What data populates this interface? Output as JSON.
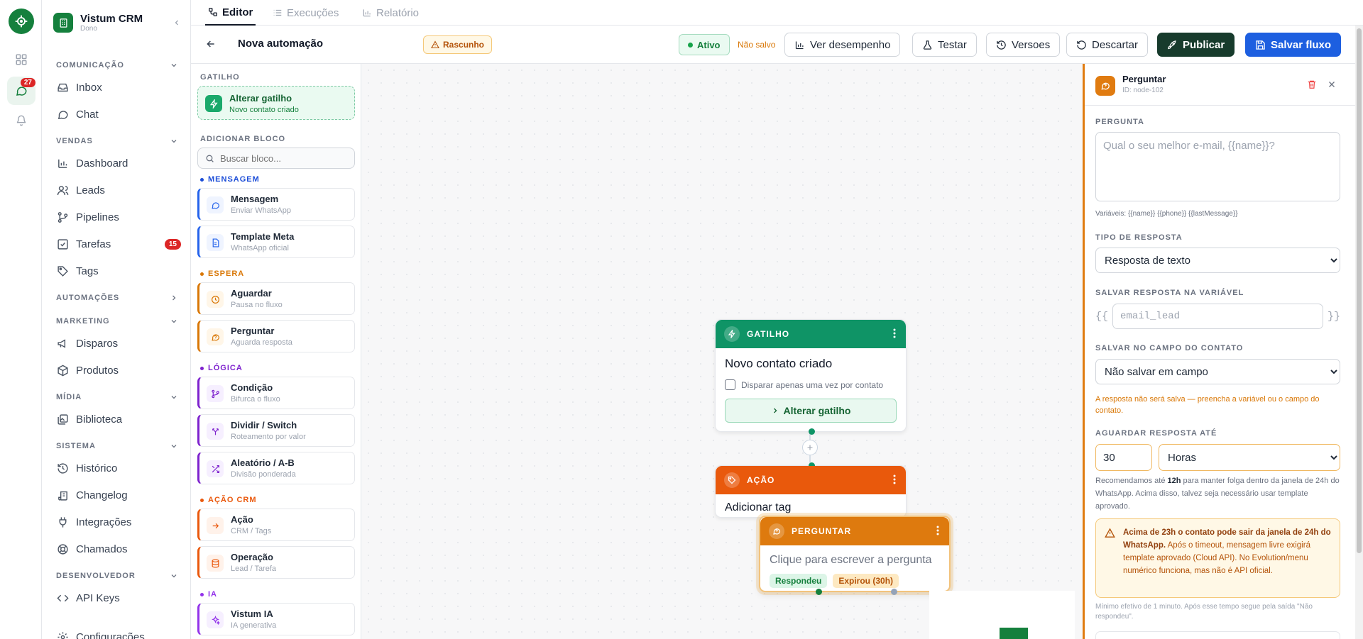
{
  "rail": {
    "badge": "27"
  },
  "workspace": {
    "name": "Vistum CRM",
    "role": "Dono"
  },
  "sidebar": {
    "comunicacao": "COMUNICAÇÃO",
    "inbox": "Inbox",
    "chat": "Chat",
    "vendas": "VENDAS",
    "dashboard": "Dashboard",
    "leads": "Leads",
    "pipelines": "Pipelines",
    "tarefas": "Tarefas",
    "tarefas_count": "15",
    "tags": "Tags",
    "automacoes": "AUTOMAÇÕES",
    "marketing": "MARKETING",
    "disparos": "Disparos",
    "produtos": "Produtos",
    "midia": "MÍDIA",
    "biblioteca": "Biblioteca",
    "sistema": "SISTEMA",
    "historico": "Histórico",
    "changelog": "Changelog",
    "integracoes": "Integrações",
    "chamados": "Chamados",
    "desenvolvedor": "DESENVOLVEDOR",
    "apikeys": "API Keys",
    "configuracoes": "Configurações"
  },
  "tabs": {
    "editor": "Editor",
    "execucoes": "Execuções",
    "relatorio": "Relatório"
  },
  "toolbar": {
    "title": "Nova automação",
    "draft": "Rascunho",
    "ativo": "Ativo",
    "nao_salvo": "Não salvo",
    "ver_desempenho": "Ver desempenho",
    "testar": "Testar",
    "versoes": "Versoes",
    "descartar": "Descartar",
    "publicar": "Publicar",
    "salvar": "Salvar fluxo"
  },
  "palette": {
    "gatilho_label": "GATILHO",
    "trigger_title": "Alterar gatilho",
    "trigger_sub": "Novo contato criado",
    "add_label": "ADICIONAR BLOCO",
    "search_placeholder": "Buscar bloco...",
    "cat_mensagem": "MENSAGEM",
    "mensagem": "Mensagem",
    "mensagem_sub": "Enviar WhatsApp",
    "template": "Template Meta",
    "template_sub": "WhatsApp oficial",
    "cat_espera": "ESPERA",
    "aguardar": "Aguardar",
    "aguardar_sub": "Pausa no fluxo",
    "perguntar": "Perguntar",
    "perguntar_sub": "Aguarda resposta",
    "cat_logica": "LÓGICA",
    "condicao": "Condição",
    "condicao_sub": "Bifurca o fluxo",
    "dividir": "Dividir / Switch",
    "dividir_sub": "Roteamento por valor",
    "aleatorio": "Aleatório / A-B",
    "aleatorio_sub": "Divisão ponderada",
    "cat_acao": "AÇÃO CRM",
    "acao": "Ação",
    "acao_sub": "CRM / Tags",
    "operacao": "Operação",
    "operacao_sub": "Lead / Tarefa",
    "cat_ia": "IA",
    "vistumia": "Vistum IA",
    "vistumia_sub": "IA generativa"
  },
  "canvas": {
    "trigger_node": {
      "header": "GATILHO",
      "title": "Novo contato criado",
      "checkbox": "Disparar apenas uma vez por contato",
      "button": "Alterar gatilho"
    },
    "action_node": {
      "header": "AÇÃO",
      "title": "Adicionar tag"
    },
    "ask_node": {
      "header": "PERGUNTAR",
      "placeholder": "Clique para escrever a pergunta",
      "answered": "Respondeu",
      "expired": "Expirou (30h)"
    }
  },
  "panel": {
    "title": "Perguntar",
    "id": "ID: node-102",
    "pergunta_label": "PERGUNTA",
    "pergunta_placeholder": "Qual o seu melhor e-mail, {{name}}?",
    "variaveis": "Variáveis: {{name}} {{phone}} {{lastMessage}}",
    "tipo_label": "TIPO DE RESPOSTA",
    "tipo_value": "Resposta de texto",
    "var_label": "SALVAR RESPOSTA NA VARIÁVEL",
    "var_open": "{{",
    "var_close": "}}",
    "var_placeholder": "email_lead",
    "campo_label": "SALVAR NO CAMPO DO CONTATO",
    "campo_value": "Não salvar em campo",
    "campo_warn": "A resposta não será salva — preencha a variável ou o campo do contato.",
    "aguardar_label": "AGUARDAR RESPOSTA ATÉ",
    "aguardar_num": "30",
    "aguardar_unit": "Horas",
    "rec_pre": "Recomendamos até ",
    "rec_bold": "12h",
    "rec_post": " para manter folga dentro da janela de 24h do WhatsApp. Acima disso, talvez seja necessário usar template aprovado.",
    "alert_bold": "Acima de 23h o contato pode sair da janela de 24h do WhatsApp.",
    "alert_text": " Após o timeout, mensagem livre exigirá template aprovado (Cloud API). No Evolution/menu numérico funciona, mas não é API oficial.",
    "minimo": "Mínimo efetivo de 1 minuto. Após esse tempo segue pela saída \"Não respondeu\"."
  },
  "colors": {
    "trigger": "#0f9466",
    "action": "#e9590c",
    "ask": "#de7a0e",
    "primary_blue": "#1d5fe0",
    "publish_dark": "#173b2c"
  }
}
